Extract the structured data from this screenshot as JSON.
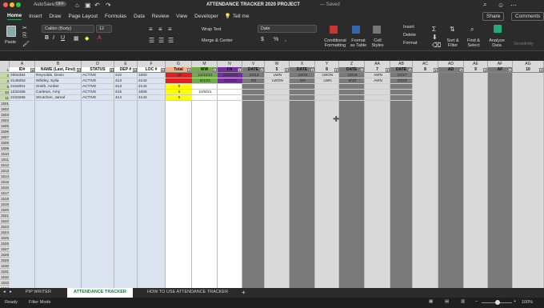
{
  "window": {
    "title": "ATTENDANCE TRACKER 2020 PROJECT",
    "saved": "— Saved",
    "autosave": "AutoSave",
    "autosave_state": "OFF"
  },
  "ribbon_tabs": [
    "Home",
    "Insert",
    "Draw",
    "Page Layout",
    "Formulas",
    "Data",
    "Review",
    "View",
    "Developer",
    "Tell me"
  ],
  "share_label": "Share",
  "comments_label": "Comments",
  "ribbon": {
    "paste": "Paste",
    "font": "Calibri (Body)",
    "size": "12",
    "wrap": "Wrap Text",
    "merge": "Merge & Center",
    "format": "Date",
    "cond": "Conditional Formatting",
    "table": "Format as Table",
    "styles": "Cell Styles",
    "insert": "Insert",
    "delete": "Delete",
    "formatc": "Format",
    "sort": "Sort & Filter",
    "find": "Find & Select",
    "analyze": "Analyze Data",
    "sensitivity": "Sensitivity"
  },
  "columns": [
    "A",
    "B",
    "D",
    "E",
    "F",
    "G",
    "M",
    "N",
    "V",
    "W",
    "X",
    "Y",
    "Z",
    "AA",
    "AB",
    "AC",
    "AD",
    "AE",
    "AF",
    "AG"
  ],
  "headers": [
    "ID#",
    "NAME (Last, First)",
    "STATUS",
    "DEP #",
    "LOC #",
    "Total",
    "WW",
    "FN",
    "DATE",
    "5",
    "DATE",
    "8",
    "DATE",
    "7",
    "DATE",
    "8",
    "AD",
    "9",
    "AF",
    "10"
  ],
  "rows": [
    {
      "r": "2",
      "c": [
        "2004394",
        "Reynolds, Devin",
        "ACTIVE",
        "410",
        "1000",
        "10",
        "12/12/21",
        "12/10/21",
        "12/14",
        "LWN",
        "12/15",
        "LWON",
        "12/16",
        "AWN",
        "12/17"
      ]
    },
    {
      "r": "3",
      "c": [
        "2146253",
        "Whitley, Sylia",
        "ACTIVE",
        "413",
        "4142",
        "",
        "8/1/21",
        "8/10/21",
        "8/1",
        "LWON",
        "8/4",
        "LWN",
        "8/10",
        "AWN",
        "10/23"
      ]
    },
    {
      "r": "9",
      "c": [
        "2164001",
        "Smith, Amber",
        "ACTIVE",
        "413",
        "4144",
        "8",
        "",
        "",
        "",
        "",
        "",
        "",
        "",
        "",
        ""
      ]
    },
    {
      "r": "10",
      "c": [
        "1334455",
        "Carleton, Amy",
        "ACTIVE",
        "415",
        "1006",
        "8",
        "12/5/21",
        "",
        "",
        "",
        "",
        "",
        "",
        "",
        ""
      ]
    },
    {
      "r": "11",
      "c": [
        "2163266",
        "Strutchen, Jamal",
        "ACTIVE",
        "414",
        "4144",
        "6",
        "",
        "",
        "",
        "",
        "",
        "",
        "",
        "",
        ""
      ]
    }
  ],
  "empty_rows": [
    "1501",
    "1502",
    "1503",
    "1504",
    "1505",
    "1506",
    "1507",
    "1508",
    "1509",
    "1510",
    "1511",
    "1512",
    "1513",
    "1514",
    "1515",
    "1516",
    "1517",
    "1518",
    "1519",
    "1520",
    "1521",
    "1522",
    "1523",
    "1524",
    "1525",
    "1526",
    "1527",
    "1528",
    "1529",
    "1530",
    "1531",
    "1532",
    "1533",
    "1534",
    "1535",
    "1536",
    "1537",
    "1538"
  ],
  "sheets": [
    "PIP WRITER",
    "ATTENDANCE TRACKER",
    "HOW TO USE ATTENDANCE TRACKER"
  ],
  "status": {
    "ready": "Ready",
    "filter": "Filter Mode",
    "zoom": "100%"
  }
}
